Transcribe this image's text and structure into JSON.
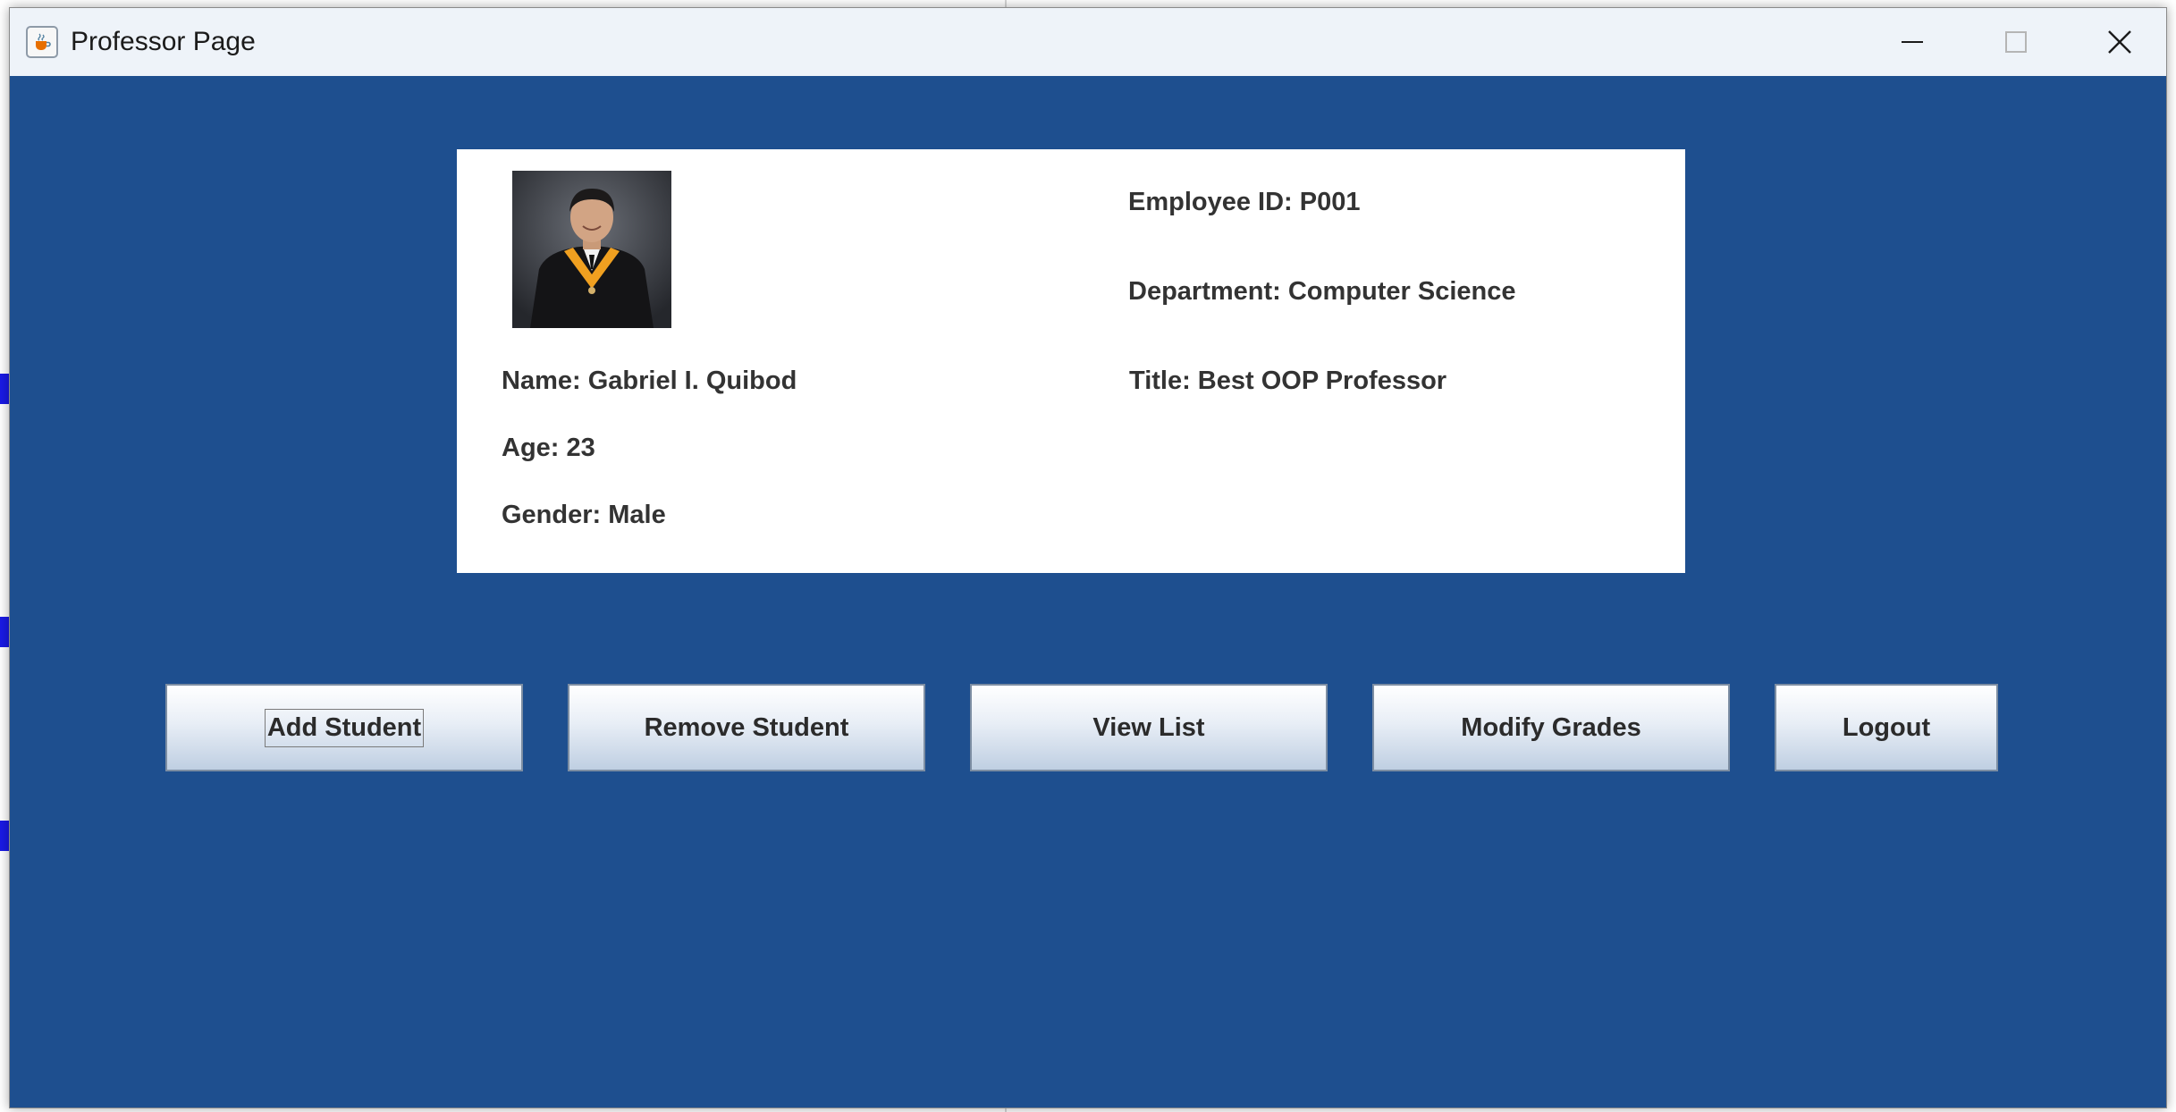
{
  "window": {
    "title": "Professor Page",
    "icon": "java-coffee-icon",
    "controls": [
      "minimize-icon",
      "maximize-icon",
      "close-icon"
    ]
  },
  "profile": {
    "photo": "professor-portrait",
    "name": "Name: Gabriel I. Quibod",
    "age": "Age: 23",
    "gender": "Gender: Male",
    "employee_id": "Employee ID: P001",
    "department": "Department: Computer Science",
    "title": "Title: Best OOP Professor"
  },
  "buttons": {
    "add_student": "Add Student",
    "remove_student": "Remove Student",
    "view_list": "View List",
    "modify_grades": "Modify Grades",
    "logout": "Logout"
  },
  "colors": {
    "background": "#1e4f8f",
    "card": "#ffffff",
    "titlebar": "#eef3f9"
  }
}
